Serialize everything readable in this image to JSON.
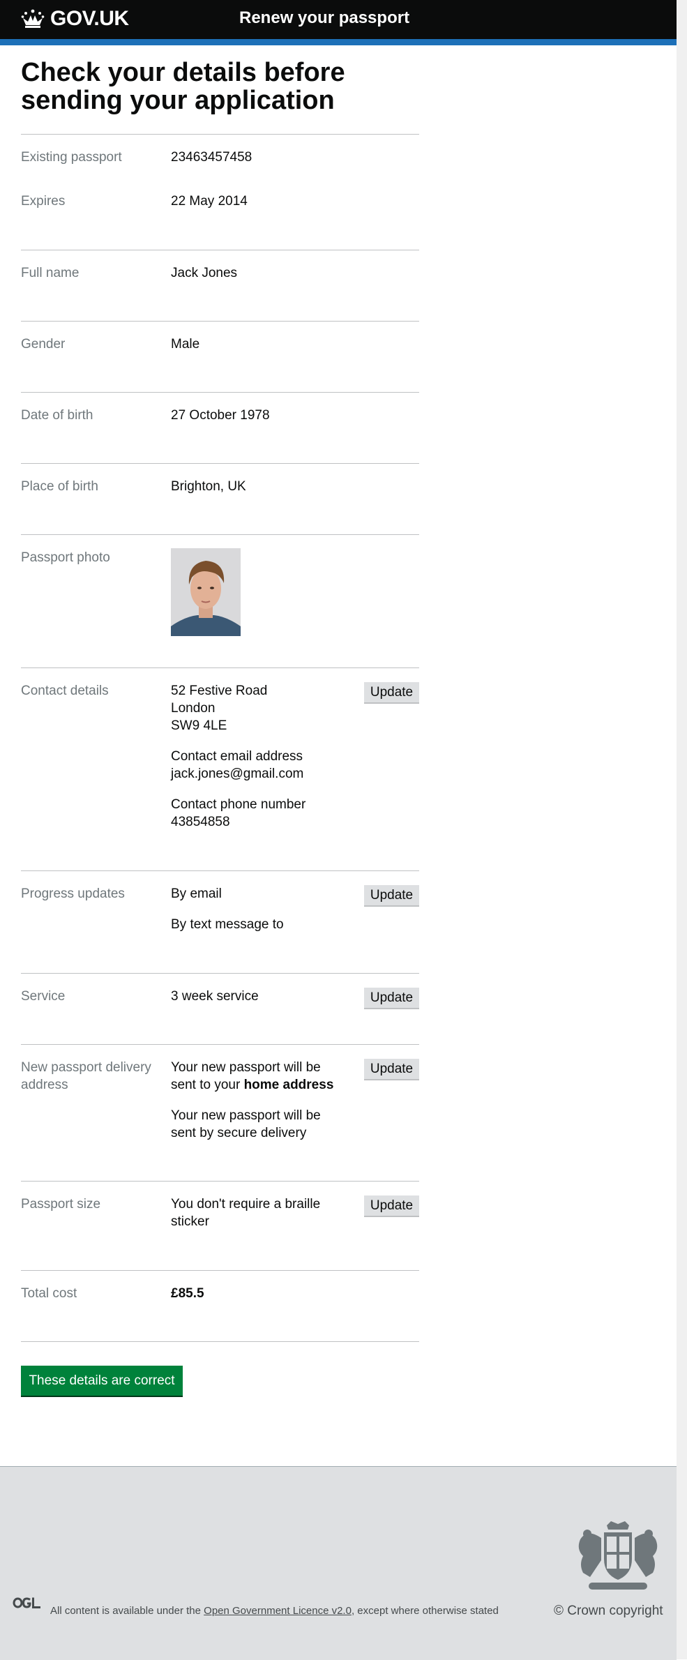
{
  "header": {
    "logo_text": "GOV.UK",
    "service_name": "Renew your passport"
  },
  "page": {
    "title": "Check your details before sending your application"
  },
  "summary": {
    "existing_passport": {
      "label": "Existing passport",
      "value": "23463457458"
    },
    "expires": {
      "label": "Expires",
      "value": "22 May 2014"
    },
    "full_name": {
      "label": "Full name",
      "value": "Jack Jones"
    },
    "gender": {
      "label": "Gender",
      "value": "Male"
    },
    "date_of_birth": {
      "label": "Date of birth",
      "value": "27 October 1978"
    },
    "place_of_birth": {
      "label": "Place of birth",
      "value": "Brighton, UK"
    },
    "passport_photo": {
      "label": "Passport photo",
      "alt": "Passport photo of Jack Jones"
    },
    "contact_details": {
      "label": "Contact details",
      "address": [
        "52 Festive Road",
        "London",
        "SW9 4LE"
      ],
      "email_label": "Contact email address",
      "email": "jack.jones@gmail.com",
      "phone_label": "Contact phone number",
      "phone": "43854858"
    },
    "progress_updates": {
      "label": "Progress updates",
      "line1": "By email",
      "line2": "By text message to"
    },
    "service": {
      "label": "Service",
      "value": "3 week service"
    },
    "delivery": {
      "label": "New passport delivery address",
      "text1_prefix": "Your new passport will be sent to your",
      "text1_bold": "home address",
      "text2": "Your new passport will be sent by secure delivery"
    },
    "passport_size": {
      "label": "Passport size",
      "value": "You don't require a braille sticker"
    },
    "total_cost": {
      "label": "Total cost",
      "value": "£85.5"
    },
    "update_label": "Update"
  },
  "confirm_button": "These details are correct",
  "footer": {
    "licence_prefix": "All content is available under the",
    "licence_link": "Open Government Licence v2.0",
    "licence_suffix": ", except where otherwise stated",
    "copyright": "© Crown copyright",
    "ogl_logo": "OGL"
  },
  "colors": {
    "header_bg": "#0b0c0c",
    "header_accent": "#1d70b8",
    "button_green": "#00823b",
    "footer_bg": "#dee0e2",
    "label_grey": "#6f777b"
  }
}
